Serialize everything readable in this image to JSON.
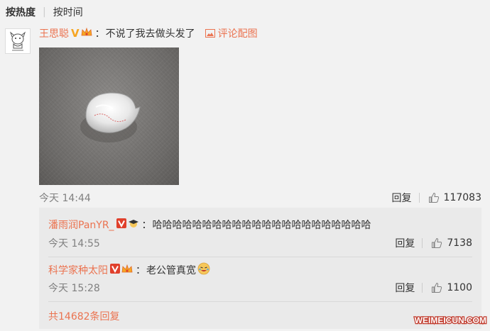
{
  "sort": {
    "hot": "按热度",
    "time": "按时间"
  },
  "main_comment": {
    "user": "王思聪",
    "badge": "V",
    "text": "不说了我去做头发了",
    "pic_link": "评论配图",
    "time": "今天 14:44",
    "reply": "回复",
    "likes": "117083"
  },
  "replies": [
    {
      "user": "潘雨润PanYR_",
      "badge": "V",
      "text": "哈哈哈哈哈哈哈哈哈哈哈哈哈哈哈哈哈哈哈哈哈哈",
      "time": "今天 14:55",
      "reply": "回复",
      "likes": "7138"
    },
    {
      "user": "科学家种太阳",
      "badge": "V",
      "text": "老公管真宽",
      "time": "今天 15:28",
      "reply": "回复",
      "likes": "1100"
    }
  ],
  "total_replies": "共14682条回复",
  "watermark": "WEIMEICUN.COM",
  "colors": {
    "accent": "#eb7350",
    "badge": "#f6a623"
  }
}
